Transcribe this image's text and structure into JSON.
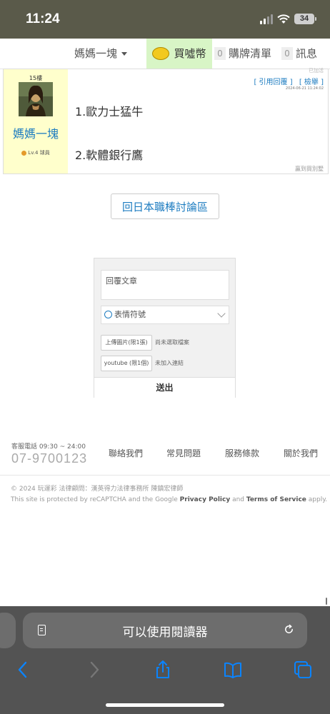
{
  "status_bar": {
    "time": "11:24",
    "battery": "34"
  },
  "nav": {
    "user": "媽媽一塊",
    "coin": "買噓幣",
    "cart_count": "0",
    "cart": "購牌清單",
    "msg_count": "0",
    "msg": "訊息"
  },
  "post": {
    "cutoff": "已加活",
    "floor": "15樓",
    "author": "媽媽一塊",
    "level": "Lv.4 球員",
    "quote": "[ 引用回覆 ]",
    "report": "[ 檢舉 ]",
    "date": "2024-06-21 11:24:02",
    "line1": "1.歐力士猛牛",
    "line2": "2.軟體銀行鷹",
    "signature": "贏到買別墅"
  },
  "back_button": "回日本職棒討論區",
  "reply_form": {
    "textarea_placeholder": "回覆文章",
    "emoji": "表情符號",
    "upload_image": "上傳圖片(限1張)",
    "upload_image_status": "尚未選取檔案",
    "youtube": "youtube (限1個)",
    "youtube_status": "未加入連結",
    "submit": "送出"
  },
  "footer": {
    "phone_label": "客服電話 09:30 ~ 24:00",
    "phone": "07-9700123",
    "links": [
      "聯絡我們",
      "常見問題",
      "服務條款",
      "關於我們"
    ],
    "copyright": "© 2024 玩運彩 法律顧問：漢英得力法律事務所 陳鎮宏律師",
    "recaptcha_pre": "This site is protected by reCAPTCHA and the Google ",
    "privacy": "Privacy Policy",
    "and": " and ",
    "terms": "Terms of Service",
    "apply": " apply."
  },
  "browser": {
    "reader": "可以使用閱讀器"
  },
  "colors": {
    "link_blue": "#1d7cc0",
    "coin_green": "#d8f5c6",
    "author_bg": "#ffffcc",
    "ios_blue": "#0a84ff"
  }
}
